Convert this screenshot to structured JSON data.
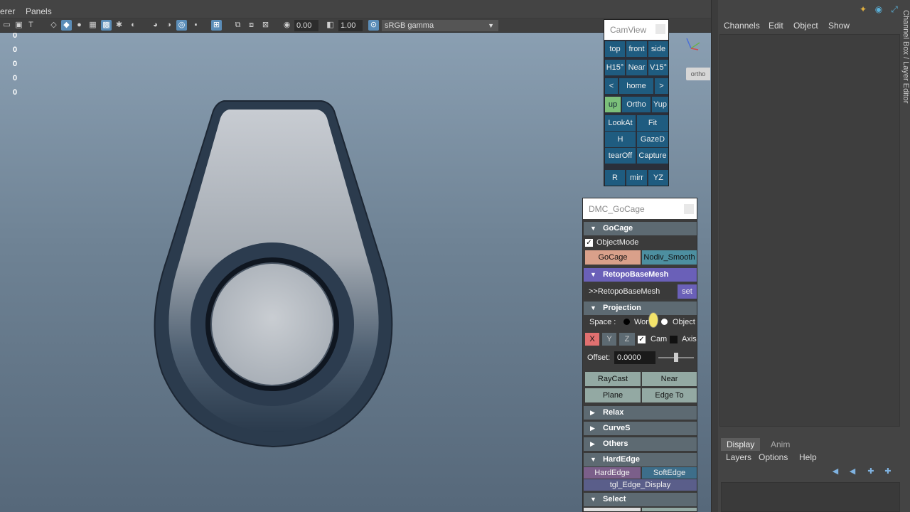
{
  "menubar": {
    "item1": "erer",
    "item2": "Panels"
  },
  "toolbar": {
    "field1": "0.00",
    "field2": "1.00",
    "color_space": "sRGB gamma"
  },
  "viewport": {
    "hud_values": [
      "0",
      "0",
      "0",
      "0",
      "0"
    ],
    "ortho_tag": "ortho"
  },
  "camview": {
    "title": "CamView",
    "buttons": {
      "top": "top",
      "front": "front",
      "side": "side",
      "h15": "H15°",
      "near": "Near",
      "v15": "V15°",
      "prev": "<",
      "home": "home",
      "next": ">",
      "up": "up",
      "ortho": "Ortho",
      "yup": "Yup",
      "lookat": "LookAt",
      "fit": "Fit",
      "h": "H",
      "gazed": "GazeD",
      "tearoff": "tearOff",
      "capture": "Capture",
      "r": "R",
      "mirr": "mirr",
      "yz": "YZ"
    }
  },
  "gocage": {
    "title": "DMC_GoCage",
    "sections": {
      "gocage": "GoCage",
      "retopo": "RetopoBaseMesh",
      "projection": "Projection",
      "relax": "Relax",
      "curves": "CurveS",
      "others": "Others",
      "hardedge": "HardEdge",
      "select": "Select"
    },
    "object_mode": "ObjectMode",
    "gocage_btn": "GoCage",
    "nodiv_btn": "Nodiv_Smooth",
    "retopo_field": ">>RetopoBaseMesh",
    "set_btn": "set",
    "space_label": "Space :",
    "space_world": "World",
    "space_object": "Object",
    "axis_x": "X",
    "axis_y": "Y",
    "axis_z": "Z",
    "cam_label": "Cam",
    "axis_label": "Axis",
    "offset_label": "Offset:",
    "offset_value": "0.0000",
    "offset_slider": 0.5,
    "raycast": "RayCast",
    "near": "Near",
    "plane": "Plane",
    "edge_to": "Edge To",
    "hardedge_btn": "HardEdge",
    "softedge_btn": "SoftEdge",
    "tgl_edge": "tgl_Edge_Display"
  },
  "channels": {
    "menu": [
      "Channels",
      "Edit",
      "Object",
      "Show"
    ],
    "side_tab": "Channel Box / Layer Editor"
  },
  "layers": {
    "tabs": [
      "Display",
      "Anim"
    ],
    "menu": [
      "Layers",
      "Options",
      "Help"
    ]
  },
  "colors": {
    "panel_blue": "#1f5c80",
    "active_green": "#7cc07a",
    "section_purple": "#6a60b8",
    "gocage_salmon": "#d9a08a"
  }
}
